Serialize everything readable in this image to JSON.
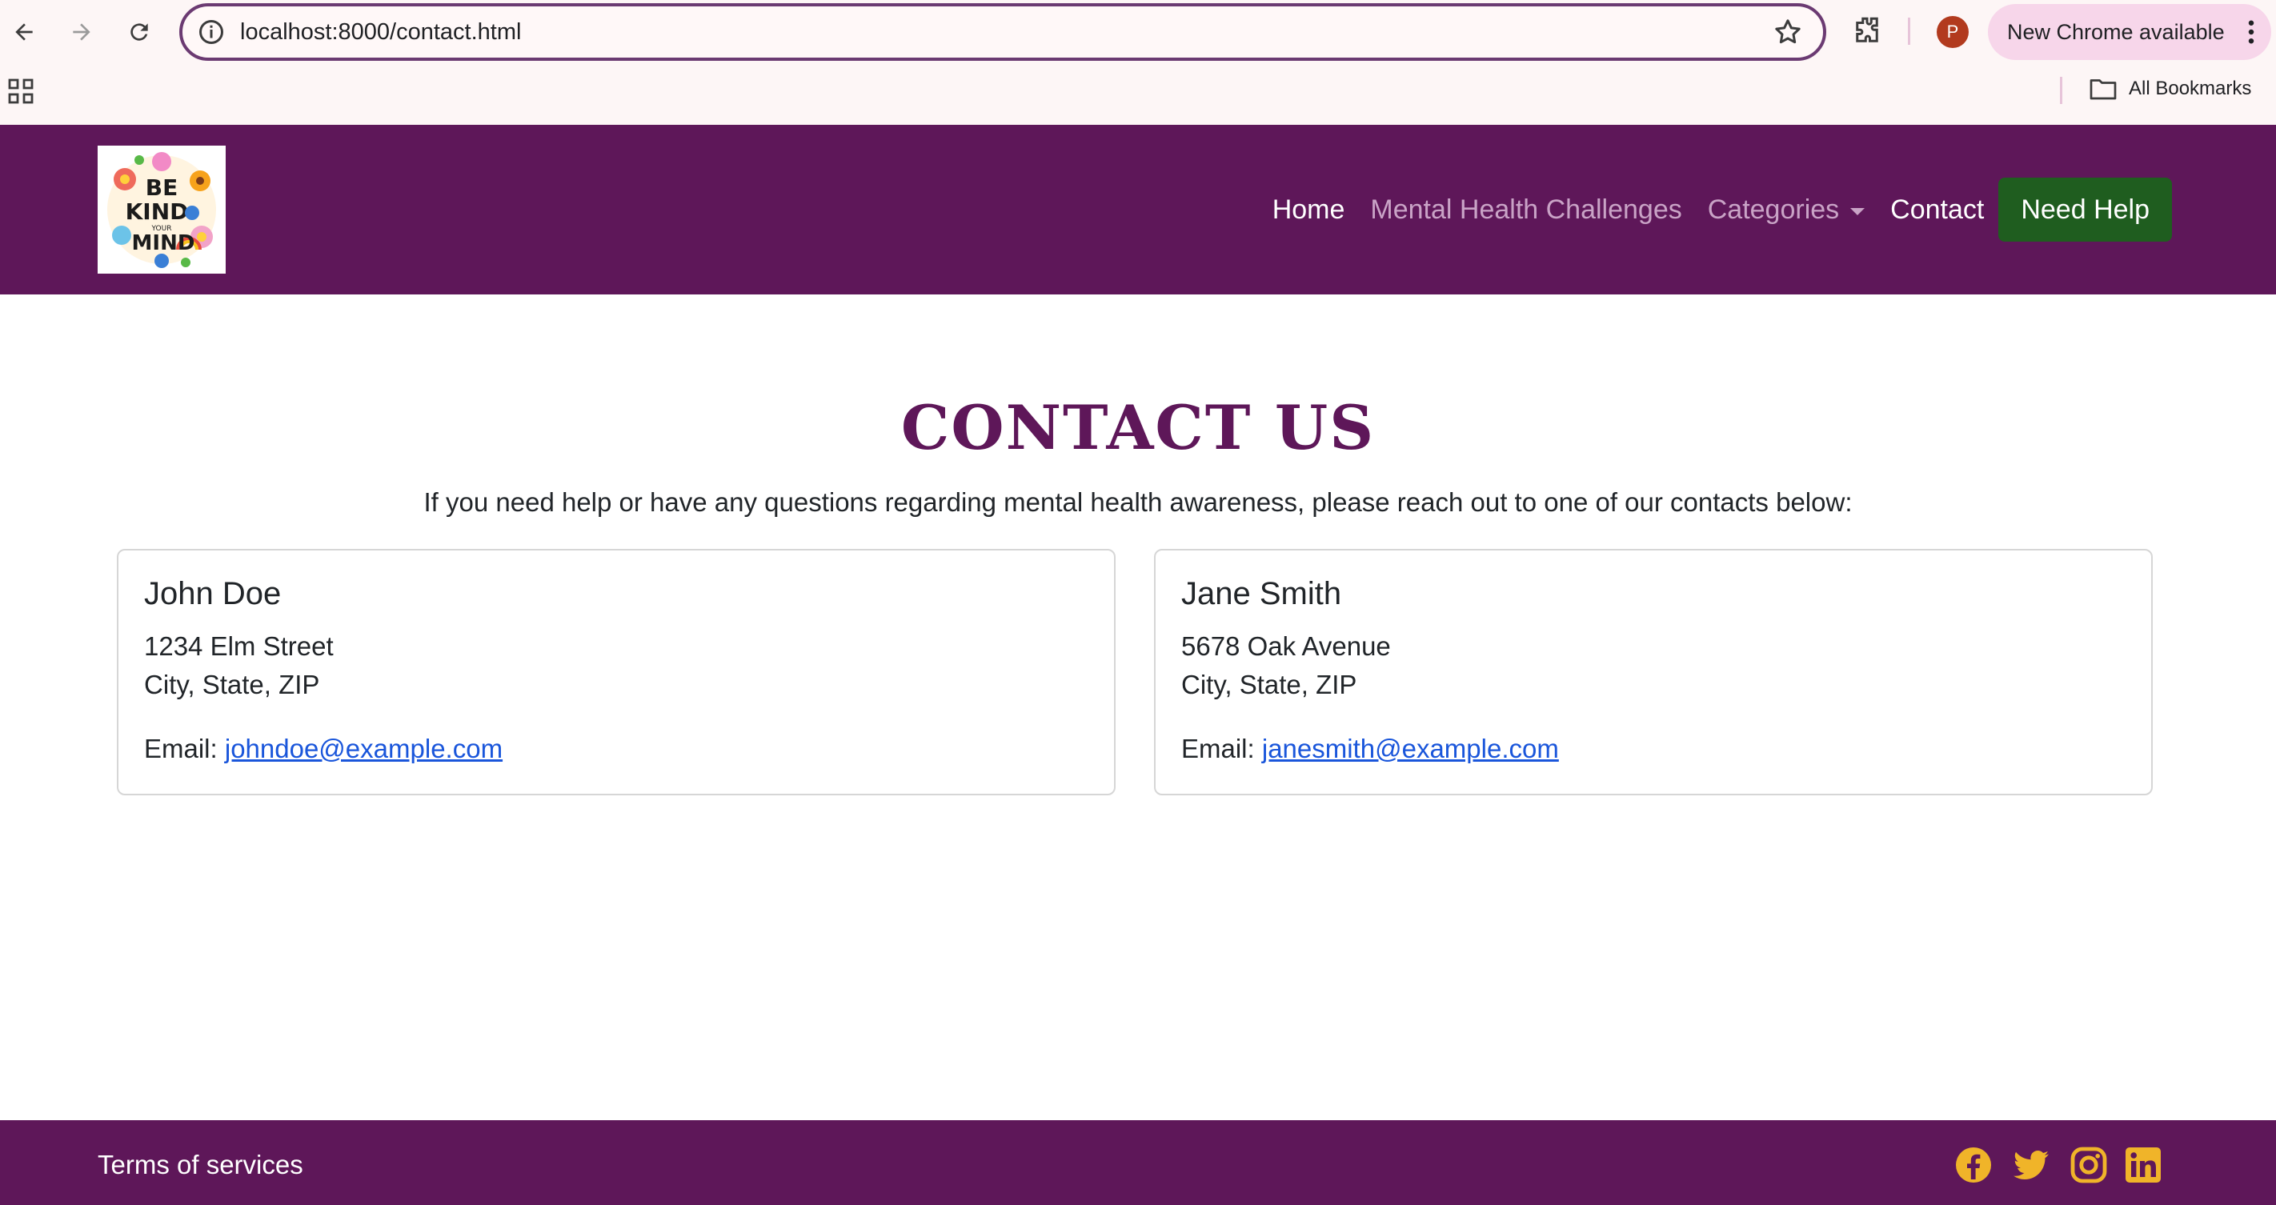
{
  "browser": {
    "url": "localhost:8000/contact.html",
    "update_label": "New Chrome available",
    "profile_initial": "P",
    "bookmarks_label": "All Bookmarks"
  },
  "nav": {
    "links": [
      "Home",
      "Mental Health Challenges",
      "Categories",
      "Contact"
    ],
    "help_button": "Need Help",
    "logo_alt": "BE KIND TO YOUR MIND"
  },
  "main": {
    "title": "CONTACT US",
    "intro": "If you need help or have any questions regarding mental health awareness, please reach out to one of our contacts below:",
    "contacts": [
      {
        "name": "John Doe",
        "address_line1": "1234 Elm Street",
        "address_line2": "City, State, ZIP",
        "email_label": "Email:",
        "email": "johndoe@example.com"
      },
      {
        "name": "Jane Smith",
        "address_line1": "5678 Oak Avenue",
        "address_line2": "City, State, ZIP",
        "email_label": "Email:",
        "email": "janesmith@example.com"
      }
    ]
  },
  "footer": {
    "terms": "Terms of services",
    "social": [
      "facebook-icon",
      "twitter-icon",
      "instagram-icon",
      "linkedin-icon"
    ]
  },
  "colors": {
    "brand_purple": "#5e1759",
    "help_green": "#1f5d1f",
    "social_gold": "#f0b429",
    "link_blue": "#1a56db"
  }
}
